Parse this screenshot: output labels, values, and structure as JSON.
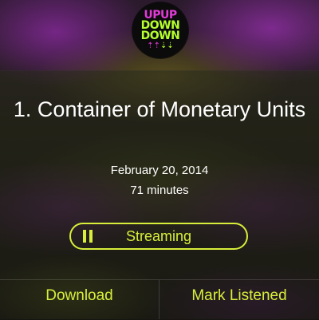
{
  "podcast": {
    "logo_lines": [
      "UPUP",
      "DOWN",
      "DOWN"
    ],
    "logo_arrows_up": "⇡⇡",
    "logo_arrows_down": "⇣⇣"
  },
  "episode": {
    "title": "1. Container of Monetary Units",
    "date": "February 20, 2014",
    "duration": "71 minutes"
  },
  "player": {
    "state_label": "Streaming",
    "icon": "pause-icon"
  },
  "actions": {
    "download_label": "Download",
    "mark_listened_label": "Mark Listened"
  },
  "colors": {
    "accent": "#d7ef3a",
    "logo_pink": "#e23bd6",
    "logo_green": "#b6ff2e"
  }
}
